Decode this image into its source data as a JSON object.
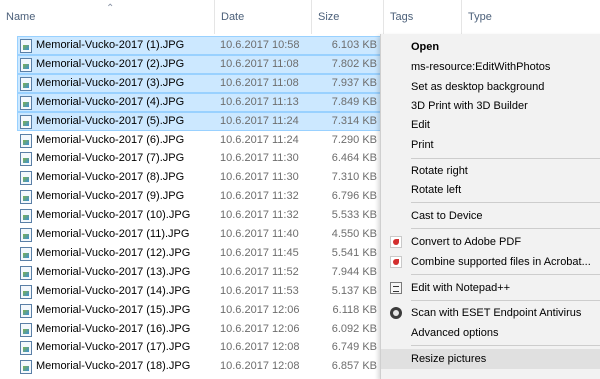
{
  "columns": {
    "name": "Name",
    "date": "Date",
    "size": "Size",
    "tags": "Tags",
    "type": "Type"
  },
  "files": [
    {
      "name": "Memorial-Vucko-2017 (1).JPG",
      "date": "10.6.2017 10:58",
      "size": "6.103 KB",
      "selected": true
    },
    {
      "name": "Memorial-Vucko-2017 (2).JPG",
      "date": "10.6.2017 11:08",
      "size": "7.802 KB",
      "selected": true
    },
    {
      "name": "Memorial-Vucko-2017 (3).JPG",
      "date": "10.6.2017 11:08",
      "size": "7.937 KB",
      "selected": true
    },
    {
      "name": "Memorial-Vucko-2017 (4).JPG",
      "date": "10.6.2017 11:13",
      "size": "7.849 KB",
      "selected": true
    },
    {
      "name": "Memorial-Vucko-2017 (5).JPG",
      "date": "10.6.2017 11:24",
      "size": "7.314 KB",
      "selected": true
    },
    {
      "name": "Memorial-Vucko-2017 (6).JPG",
      "date": "10.6.2017 11:24",
      "size": "7.290 KB",
      "selected": false
    },
    {
      "name": "Memorial-Vucko-2017 (7).JPG",
      "date": "10.6.2017 11:30",
      "size": "6.464 KB",
      "selected": false
    },
    {
      "name": "Memorial-Vucko-2017 (8).JPG",
      "date": "10.6.2017 11:30",
      "size": "7.310 KB",
      "selected": false
    },
    {
      "name": "Memorial-Vucko-2017 (9).JPG",
      "date": "10.6.2017 11:32",
      "size": "6.796 KB",
      "selected": false
    },
    {
      "name": "Memorial-Vucko-2017 (10).JPG",
      "date": "10.6.2017 11:32",
      "size": "5.533 KB",
      "selected": false
    },
    {
      "name": "Memorial-Vucko-2017 (11).JPG",
      "date": "10.6.2017 11:40",
      "size": "4.550 KB",
      "selected": false
    },
    {
      "name": "Memorial-Vucko-2017 (12).JPG",
      "date": "10.6.2017 11:45",
      "size": "5.541 KB",
      "selected": false
    },
    {
      "name": "Memorial-Vucko-2017 (13).JPG",
      "date": "10.6.2017 11:52",
      "size": "7.944 KB",
      "selected": false
    },
    {
      "name": "Memorial-Vucko-2017 (14).JPG",
      "date": "10.6.2017 11:53",
      "size": "5.137 KB",
      "selected": false
    },
    {
      "name": "Memorial-Vucko-2017 (15).JPG",
      "date": "10.6.2017 12:06",
      "size": "6.118 KB",
      "selected": false
    },
    {
      "name": "Memorial-Vucko-2017 (16).JPG",
      "date": "10.6.2017 12:06",
      "size": "6.092 KB",
      "selected": false
    },
    {
      "name": "Memorial-Vucko-2017 (17).JPG",
      "date": "10.6.2017 12:08",
      "size": "6.749 KB",
      "selected": false
    },
    {
      "name": "Memorial-Vucko-2017 (18).JPG",
      "date": "10.6.2017 12:08",
      "size": "6.857 KB",
      "selected": false
    }
  ],
  "context_menu": {
    "open": "Open",
    "edit_with_photos": "ms-resource:EditWithPhotos",
    "set_desktop_background": "Set as desktop background",
    "print_3d": "3D Print with 3D Builder",
    "edit": "Edit",
    "print": "Print",
    "rotate_right": "Rotate right",
    "rotate_left": "Rotate left",
    "cast_to_device": "Cast to Device",
    "convert_pdf": "Convert to Adobe PDF",
    "combine_acrobat": "Combine supported files in Acrobat...",
    "edit_notepad": "Edit with Notepad++",
    "scan_eset": "Scan with ESET Endpoint Antivirus",
    "advanced_options": "Advanced options",
    "resize_pictures": "Resize pictures"
  },
  "icons": {
    "file": "jpg-file-icon",
    "pdf": "adobe-pdf-icon",
    "notepad": "notepad-plus-plus-icon",
    "eset": "eset-shield-icon",
    "sort": "sort-ascending-icon"
  },
  "colors": {
    "selection_fill": "#cce8ff",
    "selection_border": "#99d1ff",
    "menu_background": "#f2f2f2",
    "menu_hover": "#e0e0e0",
    "header_text": "#4c607a"
  }
}
